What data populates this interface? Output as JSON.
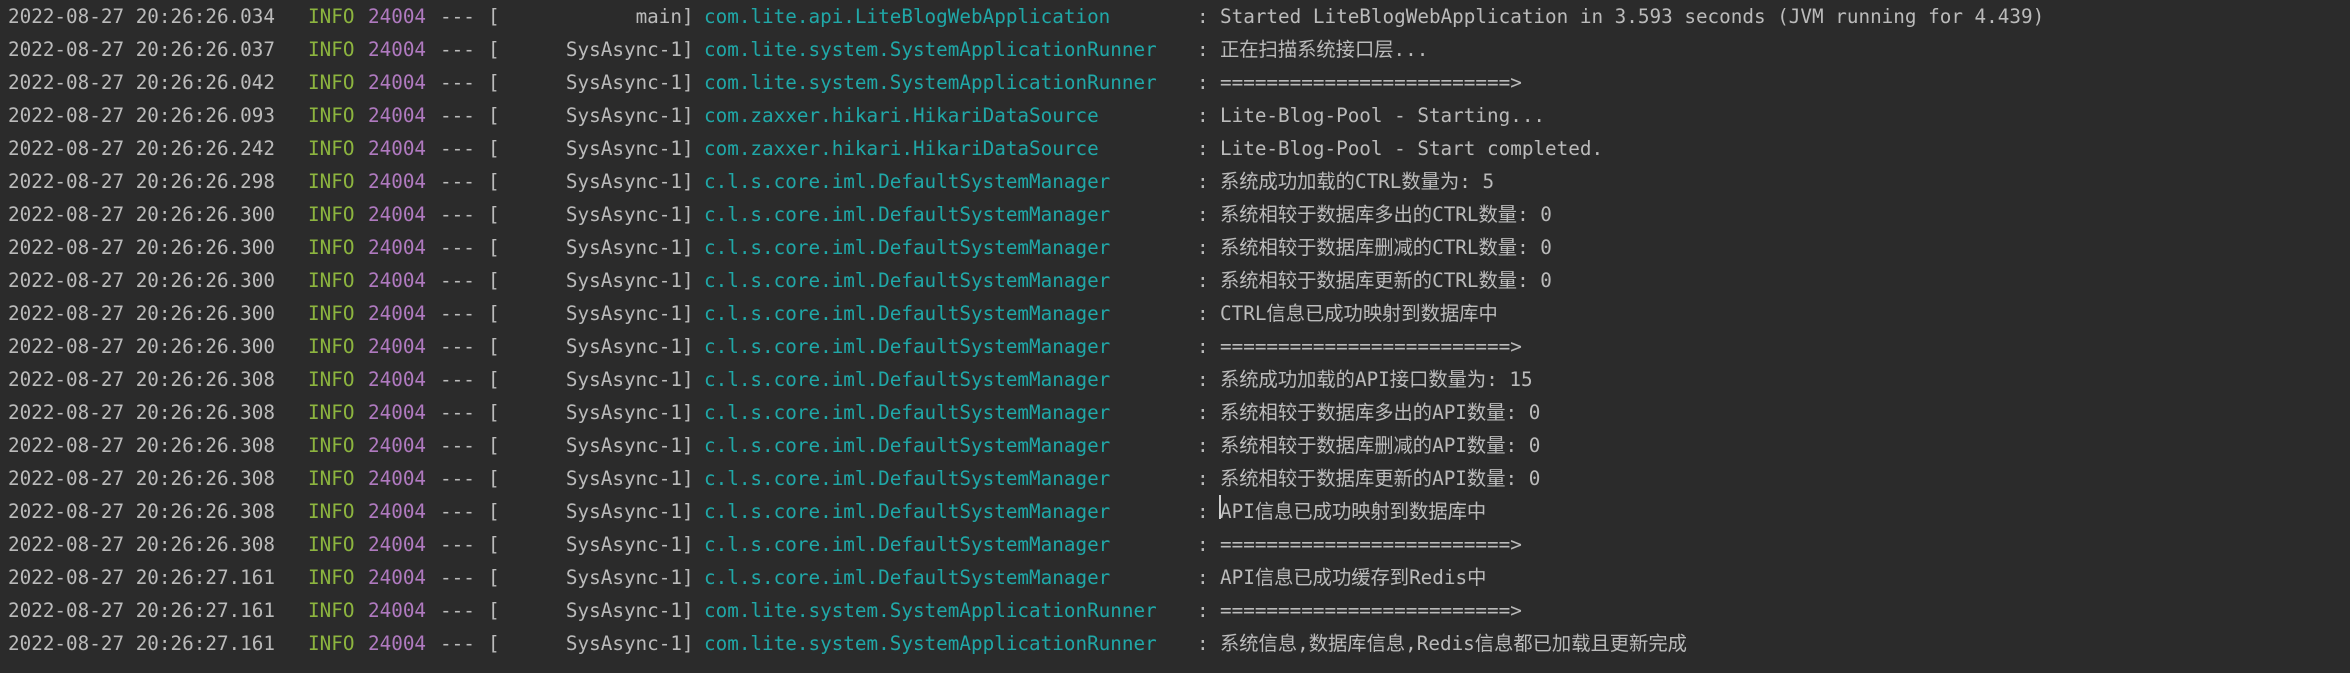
{
  "colors": {
    "background": "#2b2b2b",
    "text": "#bbbbbb",
    "level_info": "#8db53f",
    "pid": "#b07ac0",
    "logger": "#20a8a8"
  },
  "log_lines": [
    {
      "timestamp": "2022-08-27 20:26:26.034",
      "level": "INFO",
      "pid": "24004",
      "sep": "---",
      "thread": "main",
      "logger": "com.lite.api.LiteBlogWebApplication",
      "message": "Started LiteBlogWebApplication in 3.593 seconds (JVM running for 4.439)"
    },
    {
      "timestamp": "2022-08-27 20:26:26.037",
      "level": "INFO",
      "pid": "24004",
      "sep": "---",
      "thread": "SysAsync-1",
      "logger": "com.lite.system.SystemApplicationRunner",
      "message": "正在扫描系统接口层..."
    },
    {
      "timestamp": "2022-08-27 20:26:26.042",
      "level": "INFO",
      "pid": "24004",
      "sep": "---",
      "thread": "SysAsync-1",
      "logger": "com.lite.system.SystemApplicationRunner",
      "message": "=========================>"
    },
    {
      "timestamp": "2022-08-27 20:26:26.093",
      "level": "INFO",
      "pid": "24004",
      "sep": "---",
      "thread": "SysAsync-1",
      "logger": "com.zaxxer.hikari.HikariDataSource",
      "message": "Lite-Blog-Pool - Starting..."
    },
    {
      "timestamp": "2022-08-27 20:26:26.242",
      "level": "INFO",
      "pid": "24004",
      "sep": "---",
      "thread": "SysAsync-1",
      "logger": "com.zaxxer.hikari.HikariDataSource",
      "message": "Lite-Blog-Pool - Start completed."
    },
    {
      "timestamp": "2022-08-27 20:26:26.298",
      "level": "INFO",
      "pid": "24004",
      "sep": "---",
      "thread": "SysAsync-1",
      "logger": "c.l.s.core.iml.DefaultSystemManager",
      "message": "系统成功加载的CTRL数量为: 5"
    },
    {
      "timestamp": "2022-08-27 20:26:26.300",
      "level": "INFO",
      "pid": "24004",
      "sep": "---",
      "thread": "SysAsync-1",
      "logger": "c.l.s.core.iml.DefaultSystemManager",
      "message": "系统相较于数据库多出的CTRL数量: 0"
    },
    {
      "timestamp": "2022-08-27 20:26:26.300",
      "level": "INFO",
      "pid": "24004",
      "sep": "---",
      "thread": "SysAsync-1",
      "logger": "c.l.s.core.iml.DefaultSystemManager",
      "message": "系统相较于数据库删减的CTRL数量: 0"
    },
    {
      "timestamp": "2022-08-27 20:26:26.300",
      "level": "INFO",
      "pid": "24004",
      "sep": "---",
      "thread": "SysAsync-1",
      "logger": "c.l.s.core.iml.DefaultSystemManager",
      "message": "系统相较于数据库更新的CTRL数量: 0"
    },
    {
      "timestamp": "2022-08-27 20:26:26.300",
      "level": "INFO",
      "pid": "24004",
      "sep": "---",
      "thread": "SysAsync-1",
      "logger": "c.l.s.core.iml.DefaultSystemManager",
      "message": "CTRL信息已成功映射到数据库中"
    },
    {
      "timestamp": "2022-08-27 20:26:26.300",
      "level": "INFO",
      "pid": "24004",
      "sep": "---",
      "thread": "SysAsync-1",
      "logger": "c.l.s.core.iml.DefaultSystemManager",
      "message": "=========================>"
    },
    {
      "timestamp": "2022-08-27 20:26:26.308",
      "level": "INFO",
      "pid": "24004",
      "sep": "---",
      "thread": "SysAsync-1",
      "logger": "c.l.s.core.iml.DefaultSystemManager",
      "message": "系统成功加载的API接口数量为: 15"
    },
    {
      "timestamp": "2022-08-27 20:26:26.308",
      "level": "INFO",
      "pid": "24004",
      "sep": "---",
      "thread": "SysAsync-1",
      "logger": "c.l.s.core.iml.DefaultSystemManager",
      "message": "系统相较于数据库多出的API数量: 0"
    },
    {
      "timestamp": "2022-08-27 20:26:26.308",
      "level": "INFO",
      "pid": "24004",
      "sep": "---",
      "thread": "SysAsync-1",
      "logger": "c.l.s.core.iml.DefaultSystemManager",
      "message": "系统相较于数据库删减的API数量: 0"
    },
    {
      "timestamp": "2022-08-27 20:26:26.308",
      "level": "INFO",
      "pid": "24004",
      "sep": "---",
      "thread": "SysAsync-1",
      "logger": "c.l.s.core.iml.DefaultSystemManager",
      "message": "系统相较于数据库更新的API数量: 0"
    },
    {
      "timestamp": "2022-08-27 20:26:26.308",
      "level": "INFO",
      "pid": "24004",
      "sep": "---",
      "thread": "SysAsync-1",
      "logger": "c.l.s.core.iml.DefaultSystemManager",
      "message": "API信息已成功映射到数据库中"
    },
    {
      "timestamp": "2022-08-27 20:26:26.308",
      "level": "INFO",
      "pid": "24004",
      "sep": "---",
      "thread": "SysAsync-1",
      "logger": "c.l.s.core.iml.DefaultSystemManager",
      "message": "=========================>"
    },
    {
      "timestamp": "2022-08-27 20:26:27.161",
      "level": "INFO",
      "pid": "24004",
      "sep": "---",
      "thread": "SysAsync-1",
      "logger": "c.l.s.core.iml.DefaultSystemManager",
      "message": "API信息已成功缓存到Redis中"
    },
    {
      "timestamp": "2022-08-27 20:26:27.161",
      "level": "INFO",
      "pid": "24004",
      "sep": "---",
      "thread": "SysAsync-1",
      "logger": "com.lite.system.SystemApplicationRunner",
      "message": "=========================>"
    },
    {
      "timestamp": "2022-08-27 20:26:27.161",
      "level": "INFO",
      "pid": "24004",
      "sep": "---",
      "thread": "SysAsync-1",
      "logger": "com.lite.system.SystemApplicationRunner",
      "message": "系统信息,数据库信息,Redis信息都已加载且更新完成"
    }
  ]
}
